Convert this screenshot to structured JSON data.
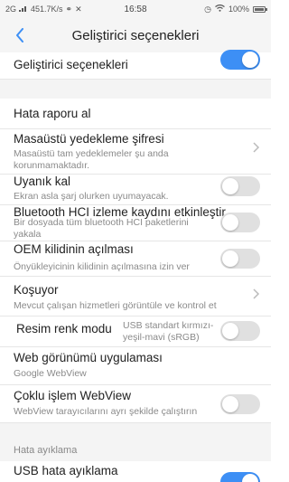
{
  "status_bar": {
    "network": "2G",
    "speed": "451.7K/s",
    "time": "16:58",
    "battery": "100%"
  },
  "header": {
    "title": "Geliştirici seçenekleri"
  },
  "colors": {
    "accent": "#3d8ff5",
    "toggle_off": "#e0e0e0",
    "secondary_text": "#8a8a8a"
  },
  "settings": {
    "developer_options": {
      "label": "Geliştirici seçenekleri",
      "enabled": true
    },
    "bug_report": {
      "label": "Hata raporu al"
    },
    "desktop_backup_password": {
      "label": "Masaüstü yedekleme şifresi",
      "summary_line1": "Masaüstü tam yedeklemeler şu anda",
      "summary_line2": "korunmamaktadır."
    },
    "stay_awake": {
      "label": "Uyanık kal",
      "summary": "Ekran asla şarj olurken uyumayacak.",
      "enabled": false
    },
    "bt_hci_log": {
      "label": "Bluetooth HCI izleme kaydını etkinleştir",
      "summary_line1": "Bir dosyada tüm bluetooth HCI paketlerini",
      "summary_line2": "yakala",
      "enabled": false
    },
    "oem_unlock": {
      "label": "OEM kilidinin açılması",
      "summary": "Önyükleyicinin kilidinin açılmasına izin ver",
      "enabled": false
    },
    "running_services": {
      "label": "Koşuyor",
      "summary": "Mevcut çalışan hizmetleri görüntüle ve kontrol et"
    },
    "color_mode": {
      "label": "Resim renk modu",
      "summary_line1": "USB standart kırmızı-",
      "summary_line2": "yeşil-mavi (sRGB)",
      "enabled": false
    },
    "webview_impl": {
      "label": "Web görünümü uygulaması",
      "summary": "Google WebView"
    },
    "multiprocess_webview": {
      "label": "Çoklu işlem WebView",
      "summary": "WebView tarayıcılarını ayrı şekilde çalıştırın",
      "enabled": false
    },
    "debugging_section": {
      "title": "Hata ayıklama"
    },
    "usb_debugging": {
      "label": "USB hata ayıklama",
      "enabled": true
    }
  }
}
